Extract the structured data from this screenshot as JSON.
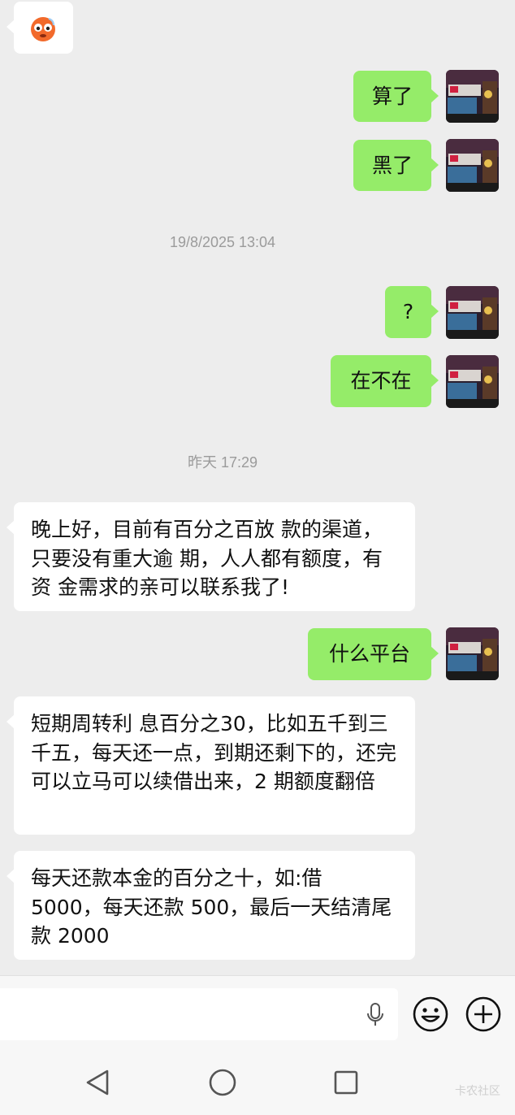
{
  "messages": {
    "m1_avatar_emoji": "🙄",
    "m2": "算了",
    "m3": "黑了",
    "t1": "19/8/2025 13:04",
    "m4": "?",
    "m5": "在不在",
    "t2": "昨天 17:29",
    "m6": "晚上好，目前有百分之百放 款的渠道，只要没有重大逾 期，人人都有额度，有资 金需求的亲可以联系我了!",
    "m7": "什么平台",
    "m8": "短期周转利 息百分之30，比如五千到三千五，每天还一点，到期还剩下的，还完可以立马可以续借出来，2 期额度翻倍",
    "m9": "每天还款本金的百分之十，如:借 5000，每天还款 500，最后一天结清尾款 2000"
  },
  "input": {
    "placeholder": ""
  },
  "icons": {
    "voice": "microphone-icon",
    "emoji": "smiley-icon",
    "plus": "plus-icon",
    "back": "back-triangle-icon",
    "home": "home-circle-icon",
    "recents": "recents-square-icon"
  },
  "colors": {
    "bubble_out": "#95ec69",
    "bubble_in": "#ffffff",
    "background": "#ededed"
  },
  "watermark": "卡农社区"
}
